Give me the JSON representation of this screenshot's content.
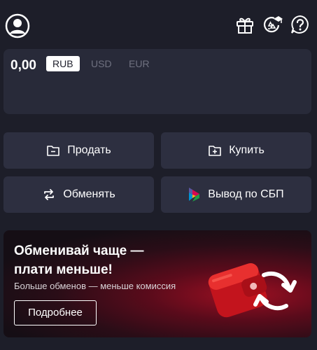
{
  "header": {
    "icons": [
      "user-avatar-icon",
      "gift-icon",
      "rewards-icon",
      "help-icon"
    ]
  },
  "balance": {
    "amount": "0,00",
    "currencies": [
      "RUB",
      "USD",
      "EUR"
    ],
    "selected": "RUB"
  },
  "actions": {
    "sell_label": "Продать",
    "buy_label": "Купить",
    "exchange_label": "Обменять",
    "sbp_label": "Вывод по СБП"
  },
  "promo": {
    "title": "Обменивай чаще — плати меньше!",
    "subtitle": "Больше обменов — меньше комиссия",
    "button_label": "Подробнее"
  },
  "colors": {
    "background": "#1d1e29",
    "card": "#282a39",
    "button": "#2d2f40",
    "promo_accent": "#e8242b"
  }
}
